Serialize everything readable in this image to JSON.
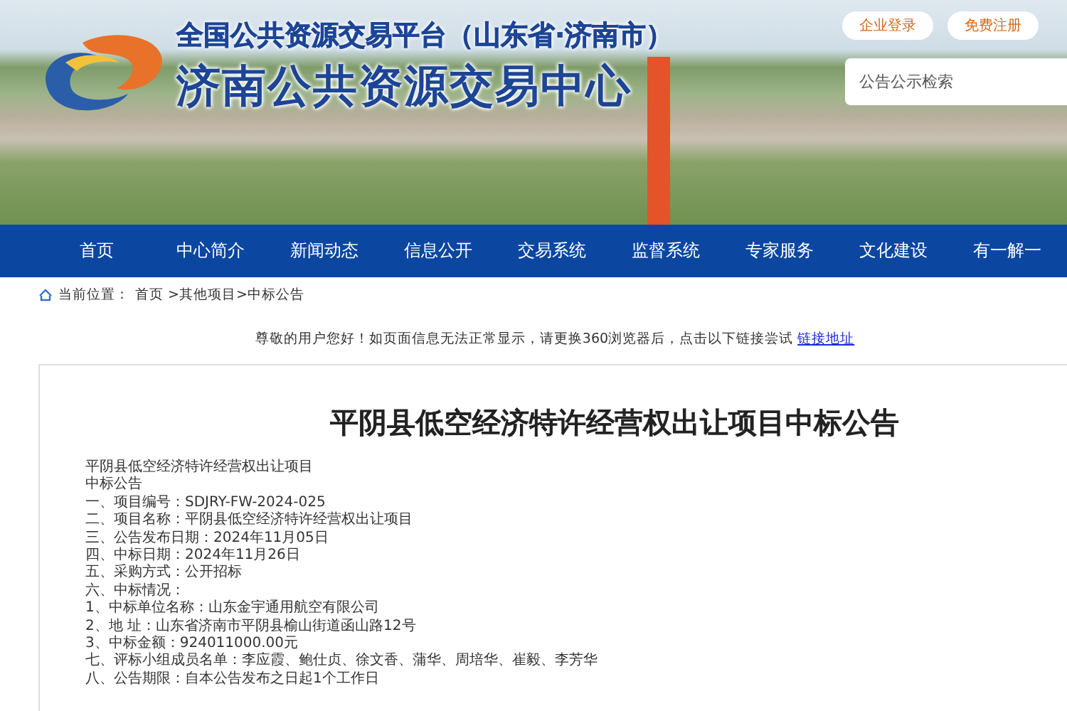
{
  "header": {
    "subtitle": "全国公共资源交易平台（山东省·济南市）",
    "title": "济南公共资源交易中心",
    "buttons": [
      "企业登录",
      "免费注册"
    ],
    "search": {
      "placeholder": "公告公示检索"
    }
  },
  "nav": [
    "首页",
    "中心简介",
    "新闻动态",
    "信息公开",
    "交易系统",
    "监督系统",
    "专家服务",
    "文化建设",
    "有一解一"
  ],
  "breadcrumb": {
    "label": "当前位置：",
    "path": "首页 >其他项目>中标公告"
  },
  "notice": {
    "text": "尊敬的用户您好！如页面信息无法正常显示，请更换360浏览器后，点击以下链接尝试",
    "link": "链接地址"
  },
  "article": {
    "title": "平阴县低空经济特许经营权出让项目中标公告",
    "lines": [
      "平阴县低空经济特许经营权出让项目",
      "中标公告",
      "一、项目编号：SDJRY-FW-2024-025",
      "二、项目名称：平阴县低空经济特许经营权出让项目",
      "三、公告发布日期：2024年11月05日",
      "四、中标日期：2024年11月26日",
      "五、采购方式：公开招标",
      "六、中标情况：",
      "1、中标单位名称：山东金宇通用航空有限公司",
      "2、地 址：山东省济南市平阴县榆山街道函山路12号",
      "3、中标金额：924011000.00元",
      "七、评标小组成员名单：李应霞、鲍仕贞、徐文香、蒲华、周培华、崔毅、李芳华",
      "八、公告期限：自本公告发布之日起1个工作日"
    ]
  }
}
